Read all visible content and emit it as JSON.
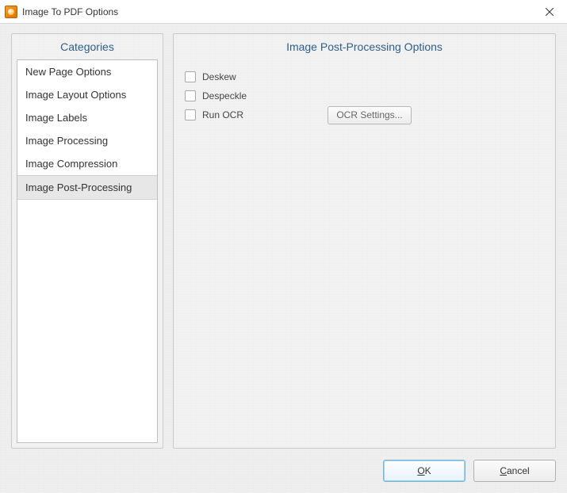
{
  "window": {
    "title": "Image To PDF Options"
  },
  "panels": {
    "categories_header": "Categories",
    "right_header": "Image Post-Processing Options"
  },
  "categories": {
    "items": [
      {
        "label": "New Page Options"
      },
      {
        "label": "Image Layout Options"
      },
      {
        "label": "Image Labels"
      },
      {
        "label": "Image Processing"
      },
      {
        "label": "Image Compression"
      },
      {
        "label": "Image Post-Processing"
      }
    ],
    "selected_index": 5
  },
  "options": {
    "deskew": {
      "label": "Deskew",
      "checked": false
    },
    "despeckle": {
      "label": "Despeckle",
      "checked": false
    },
    "run_ocr": {
      "label": "Run OCR",
      "checked": false
    },
    "ocr_settings_button": "OCR Settings..."
  },
  "buttons": {
    "ok_prefix": "O",
    "ok_rest": "K",
    "cancel_prefix": "C",
    "cancel_rest": "ancel"
  }
}
